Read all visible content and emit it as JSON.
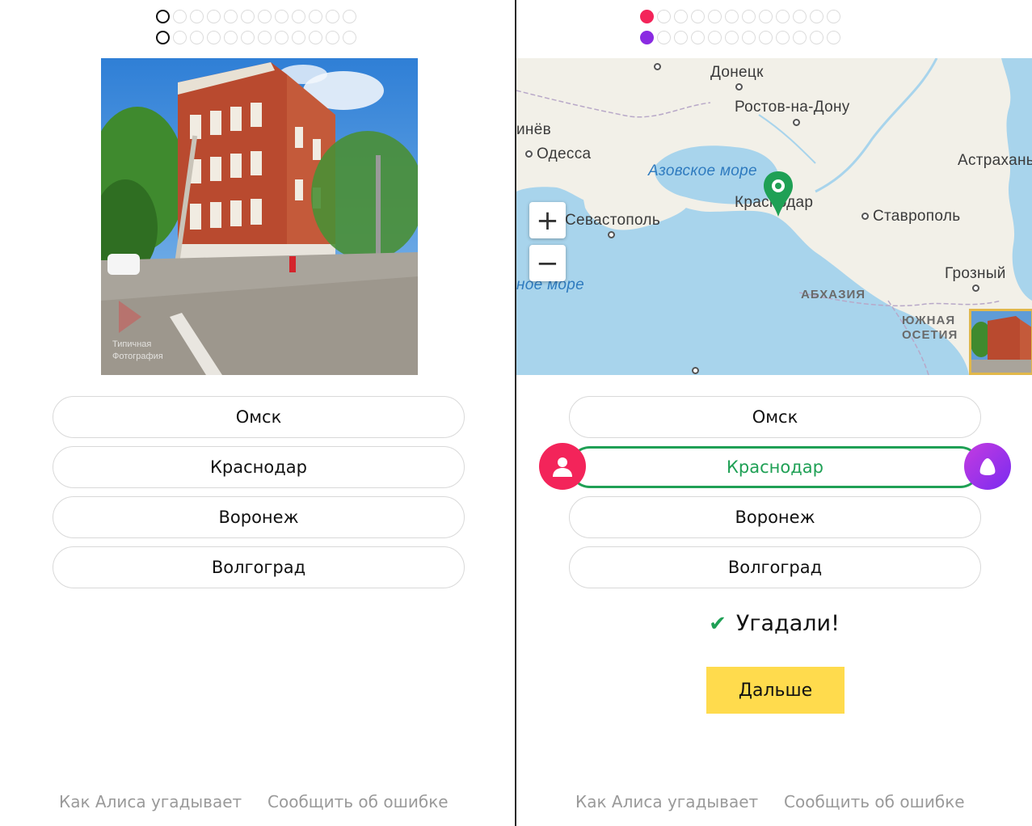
{
  "progress": {
    "left": {
      "row1_total": 12,
      "row1_current": 0,
      "row2_total": 12,
      "row2_current": 0
    },
    "right": {
      "row1_total": 12,
      "row1_marked": 0,
      "row1_color": "#f3245a",
      "row2_total": 12,
      "row2_marked": 0,
      "row2_color": "#8a2be2"
    }
  },
  "photo": {
    "watermark_line1": "Типичная",
    "watermark_line2": "Фотография"
  },
  "options": [
    "Омск",
    "Краснодар",
    "Воронеж",
    "Волгоград"
  ],
  "selected_option": "Краснодар",
  "map": {
    "cities": {
      "donetsk": "Донецк",
      "rostov": "Ростов-на-Дону",
      "kishinev": "инёв",
      "odessa": "Одесса",
      "astrakhan": "Астрахань",
      "sevastopol": "Севастополь",
      "krasnodar": "Краснодар",
      "stavropol": "Ставрополь",
      "grozny": "Грозный"
    },
    "seas": {
      "azov": "Азовское море",
      "black": "ное море"
    },
    "regions": {
      "abkhazia": "АБХАЗИЯ",
      "south_ossetia_1": "ЮЖНАЯ",
      "south_ossetia_2": "ОСЕТИЯ"
    },
    "zoom_in": "+",
    "zoom_out": "−"
  },
  "result": {
    "text": "Угадали!",
    "check": "✔"
  },
  "next_button": "Дальше",
  "footer": {
    "how_alice": "Как Алиса угадывает",
    "report_error": "Сообщить об ошибке"
  },
  "colors": {
    "correct": "#1fa055",
    "user_avatar": "#f3245a",
    "alice_avatar": "#8a2be2",
    "next_button": "#ffdb4d"
  }
}
